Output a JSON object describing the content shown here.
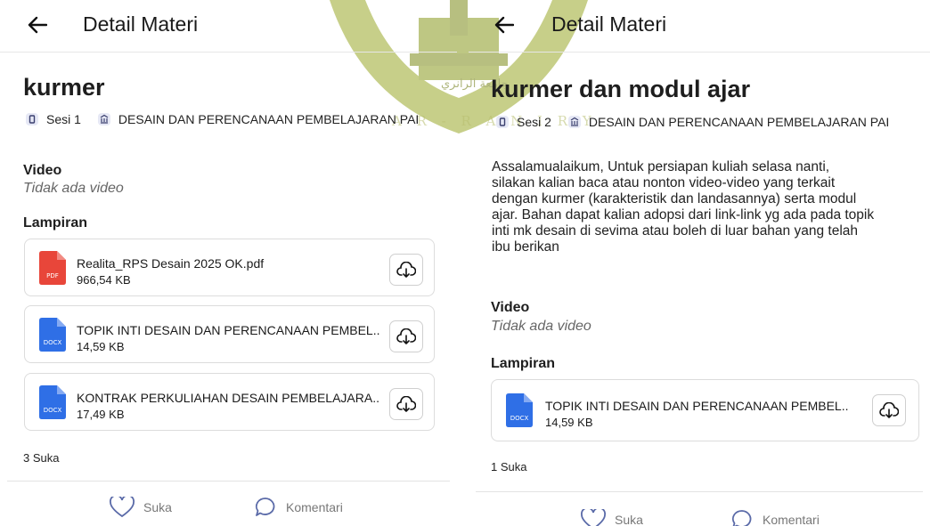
{
  "watermark": {
    "arabic": "جامعة الرانري",
    "latin": "A R - R A N I R Y",
    "color": "#8a9a1e"
  },
  "colors": {
    "pdf": "#e8463a",
    "docx": "#2f6fe6"
  },
  "left": {
    "header_title": "Detail Materi",
    "title": "kurmer",
    "session": "Sesi 1",
    "course": "DESAIN DAN PERENCANAAN PEMBELAJARAN PAI",
    "video_label": "Video",
    "video_empty": "Tidak ada video",
    "attachments_label": "Lampiran",
    "attachments": [
      {
        "type": "PDF",
        "icon": "pdf-file-icon",
        "name": "Realita_RPS Desain 2025 OK.pdf",
        "size": "966,54 KB"
      },
      {
        "type": "DOCX",
        "icon": "docx-file-icon",
        "name": "TOPIK INTI DESAIN DAN PERENCANAAN PEMBEL...",
        "size": "14,59 KB"
      },
      {
        "type": "DOCX",
        "icon": "docx-file-icon",
        "name": "KONTRAK PERKULIAHAN DESAIN PEMBELAJARA...",
        "size": "17,49 KB"
      }
    ],
    "likes": "3 Suka",
    "like_label": "Suka",
    "comment_label": "Komentari"
  },
  "right": {
    "header_title": "Detail Materi",
    "title": "kurmer dan modul ajar",
    "session": "Sesi 2",
    "course": "DESAIN DAN PERENCANAAN PEMBELAJARAN PAI",
    "description_lines": [
      "Assalamualaikum, Untuk persiapan kuliah selasa nanti,",
      "silakan kalian baca atau nonton video-video yang terkait",
      "dengan kurmer (karakteristik dan landasannya) serta modul",
      "ajar. Bahan dapat kalian adopsi dari link-link yg ada pada topik",
      "inti mk desain di sevima atau boleh di luar bahan yang telah",
      "ibu berikan"
    ],
    "video_label": "Video",
    "video_empty": "Tidak ada video",
    "attachments_label": "Lampiran",
    "attachments": [
      {
        "type": "DOCX",
        "icon": "docx-file-icon",
        "name": "TOPIK INTI DESAIN DAN PERENCANAAN PEMBEL...",
        "size": "14,59 KB"
      }
    ],
    "likes": "1 Suka",
    "like_label": "Suka",
    "comment_label": "Komentari"
  }
}
